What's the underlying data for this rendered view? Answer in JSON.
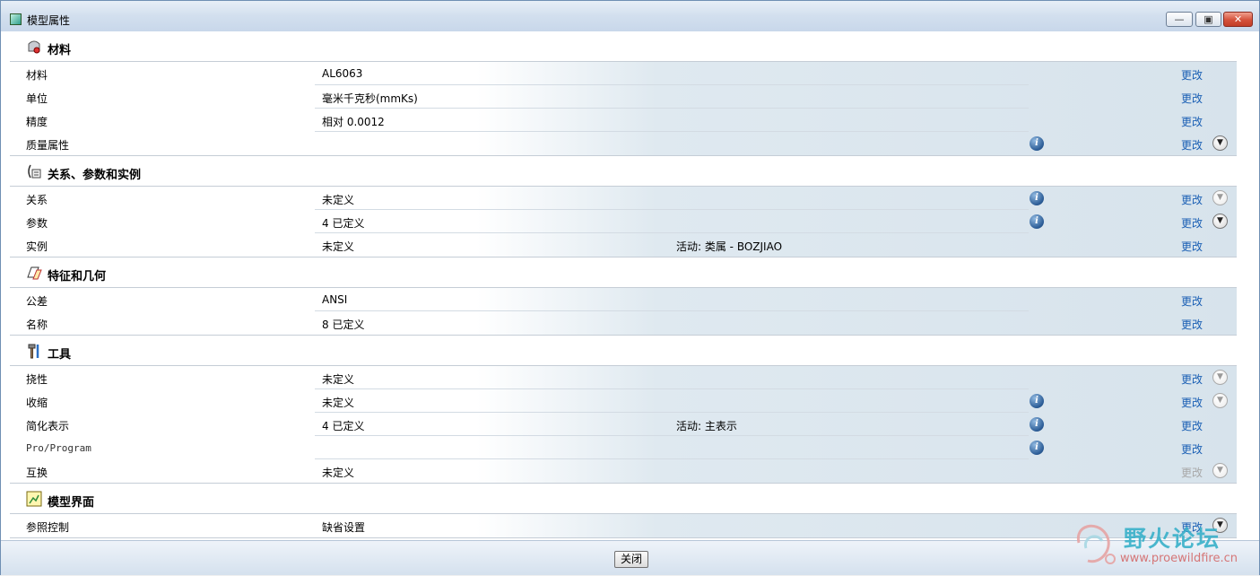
{
  "window": {
    "title": "模型属性",
    "minimize_glyph": "—",
    "maximize_glyph": "▣",
    "close_glyph": "✕"
  },
  "sections": [
    {
      "title": "材料",
      "icon": "material-icon",
      "rows": [
        {
          "label": "材料",
          "value": "AL6063",
          "extra": "",
          "info": false,
          "change": "更改",
          "enabled": true,
          "expand": "none"
        },
        {
          "label": "单位",
          "value": "毫米千克秒(mmKs)",
          "extra": "",
          "info": false,
          "change": "更改",
          "enabled": true,
          "expand": "none"
        },
        {
          "label": "精度",
          "value": "相对 0.0012",
          "extra": "",
          "info": false,
          "change": "更改",
          "enabled": true,
          "expand": "none"
        },
        {
          "label": "质量属性",
          "value": "",
          "extra": "",
          "info": true,
          "change": "更改",
          "enabled": true,
          "expand": "dark"
        }
      ]
    },
    {
      "title": "关系、参数和实例",
      "icon": "relations-icon",
      "rows": [
        {
          "label": "关系",
          "value": "未定义",
          "extra": "",
          "info": true,
          "change": "更改",
          "enabled": true,
          "expand": "light"
        },
        {
          "label": "参数",
          "value": "4 已定义",
          "extra": "",
          "info": true,
          "change": "更改",
          "enabled": true,
          "expand": "dark"
        },
        {
          "label": "实例",
          "value": "未定义",
          "extra": "活动: 类属 - BOZJIAO",
          "info": false,
          "change": "更改",
          "enabled": true,
          "expand": "none"
        }
      ]
    },
    {
      "title": "特征和几何",
      "icon": "features-icon",
      "rows": [
        {
          "label": "公差",
          "value": "ANSI",
          "extra": "",
          "info": false,
          "change": "更改",
          "enabled": true,
          "expand": "none"
        },
        {
          "label": "名称",
          "value": "8 已定义",
          "extra": "",
          "info": false,
          "change": "更改",
          "enabled": true,
          "expand": "none"
        }
      ]
    },
    {
      "title": "工具",
      "icon": "tools-icon",
      "rows": [
        {
          "label": "挠性",
          "value": "未定义",
          "extra": "",
          "info": false,
          "change": "更改",
          "enabled": true,
          "expand": "light"
        },
        {
          "label": "收缩",
          "value": "未定义",
          "extra": "",
          "info": true,
          "change": "更改",
          "enabled": true,
          "expand": "light"
        },
        {
          "label": "简化表示",
          "value": "4 已定义",
          "extra": "活动: 主表示",
          "info": true,
          "change": "更改",
          "enabled": true,
          "expand": "none"
        },
        {
          "label": "Pro/Program",
          "value": "",
          "extra": "",
          "info": true,
          "change": "更改",
          "enabled": true,
          "expand": "none"
        },
        {
          "label": "互换",
          "value": "未定义",
          "extra": "",
          "info": false,
          "change": "更改",
          "enabled": false,
          "expand": "light"
        }
      ]
    },
    {
      "title": "模型界面",
      "icon": "model-interface-icon",
      "rows": [
        {
          "label": "参照控制",
          "value": "缺省设置",
          "extra": "",
          "info": false,
          "change": "更改",
          "enabled": true,
          "expand": "dark"
        }
      ]
    }
  ],
  "footer": {
    "close_label": "关闭"
  },
  "watermark": {
    "text_cn": "野火论坛",
    "url": "www.proewildfire.cn"
  }
}
